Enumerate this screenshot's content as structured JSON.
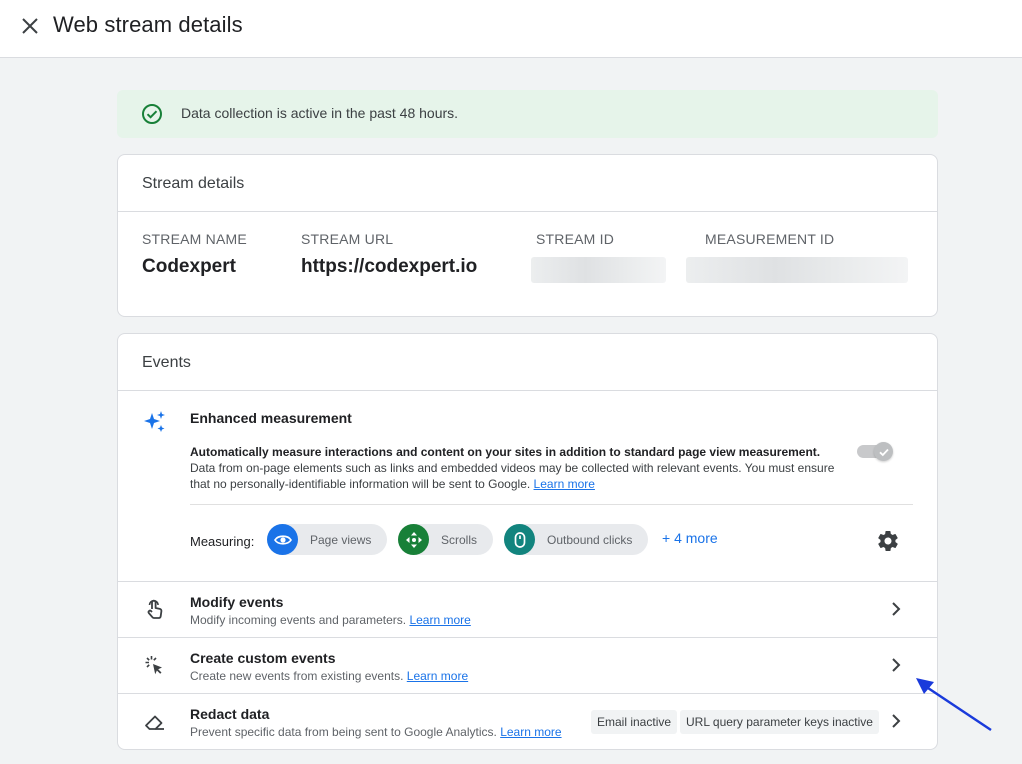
{
  "header": {
    "title": "Web stream details",
    "close_icon": "close-icon"
  },
  "banner": {
    "text": "Data collection is active in the past 48 hours.",
    "icon": "check-circle-icon",
    "color": "#e6f4ea"
  },
  "stream_details": {
    "title": "Stream details",
    "columns": [
      {
        "label": "STREAM NAME",
        "value": "Codexpert"
      },
      {
        "label": "STREAM URL",
        "value": "https://codexpert.io"
      },
      {
        "label": "STREAM ID",
        "value": ""
      },
      {
        "label": "MEASUREMENT ID",
        "value": ""
      }
    ]
  },
  "events": {
    "title": "Events",
    "enhanced": {
      "title": "Enhanced measurement",
      "desc_bold": "Automatically measure interactions and content on your sites in addition to standard page view measurement.",
      "desc_rest": "Data from on-page elements such as links and embedded videos may be collected with relevant events. You must ensure that no personally-identifiable information will be sent to Google.",
      "learn_more": "Learn more",
      "toggle_on": true,
      "measuring_label": "Measuring:",
      "chips": [
        {
          "label": "Page views",
          "icon": "eye-icon",
          "color": "#1a73e8"
        },
        {
          "label": "Scrolls",
          "icon": "scroll-icon",
          "color": "#188038"
        },
        {
          "label": "Outbound clicks",
          "icon": "mouse-icon",
          "color": "#12847e"
        }
      ],
      "more": "+ 4 more"
    },
    "rows": [
      {
        "title": "Modify events",
        "desc": "Modify incoming events and parameters.",
        "learn_more": "Learn more",
        "icon": "touch-icon"
      },
      {
        "title": "Create custom events",
        "desc": "Create new events from existing events.",
        "learn_more": "Learn more",
        "icon": "sparkle-cursor-icon"
      },
      {
        "title": "Redact data",
        "desc": "Prevent specific data from being sent to Google Analytics.",
        "learn_more": "Learn more",
        "icon": "eraser-icon",
        "tags": [
          "Email inactive",
          "URL query parameter keys inactive"
        ]
      }
    ]
  },
  "colors": {
    "accent": "#1a73e8",
    "annotation_arrow": "#1a3adb"
  }
}
